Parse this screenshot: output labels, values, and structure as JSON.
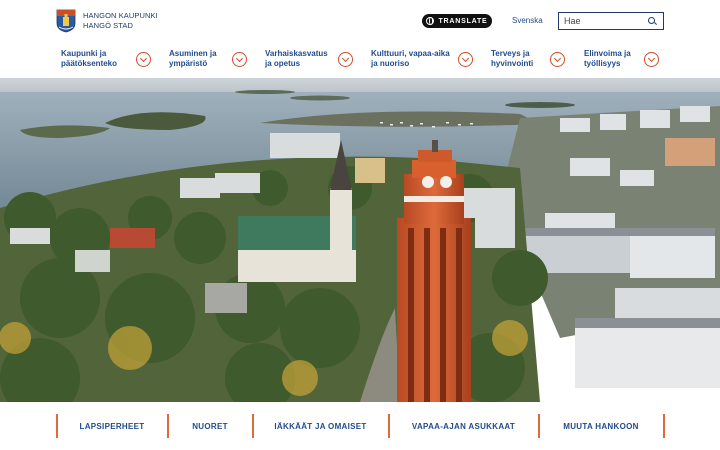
{
  "header": {
    "logo_line1": "HANGON KAUPUNKI",
    "logo_line2": "HANGÖ STAD",
    "translate_label": "TRANSLATE",
    "language_link": "Svenska",
    "search_placeholder": "Hae"
  },
  "nav": {
    "items": [
      {
        "line1": "Kaupunki ja",
        "line2": "päätöksenteko"
      },
      {
        "line1": "Asuminen ja",
        "line2": "ympäristö"
      },
      {
        "line1": "Varhaiskasvatus",
        "line2": "ja opetus"
      },
      {
        "line1": "Kulttuuri, vapaa-aika",
        "line2": "ja nuoriso"
      },
      {
        "line1": "Terveys ja",
        "line2": "hyvinvointi"
      },
      {
        "line1": "Elinvoima ja",
        "line2": "työllisyys"
      }
    ]
  },
  "audience_links": [
    "LAPSIPERHEET",
    "NUORET",
    "IÄKKÄÄT JA OMAISET",
    "VAPAA-AJAN ASUKKAAT",
    "MUUTA HANKOON"
  ],
  "colors": {
    "brand_blue": "#1f3a6b",
    "link_blue": "#1f4b8f",
    "accent_orange": "#c94f2a"
  },
  "icons": {
    "globe": "globe-icon",
    "search": "search-icon",
    "chevron": "chevron-down-icon"
  }
}
